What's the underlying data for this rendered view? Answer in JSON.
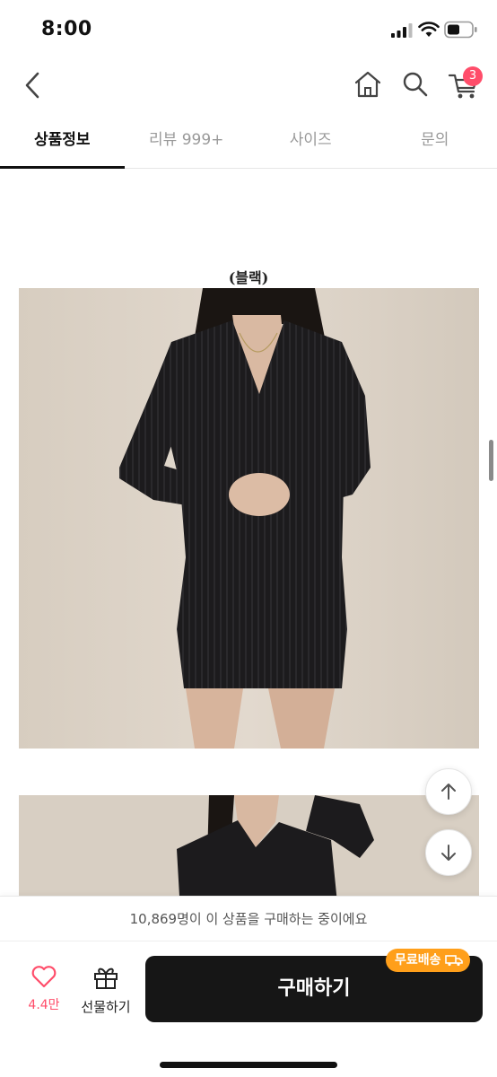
{
  "status_bar": {
    "time": "8:00",
    "icons": [
      "signal-icon",
      "wifi-icon",
      "battery-icon"
    ]
  },
  "nav": {
    "icons": [
      "back-icon",
      "home-icon",
      "search-icon",
      "cart-icon"
    ],
    "cart_badge": "3",
    "badge_color": "#ff4d6a"
  },
  "tabs": [
    {
      "label": "상품정보",
      "active": true
    },
    {
      "label": "리뷰 999+",
      "active": false
    },
    {
      "label": "사이즈",
      "active": false
    },
    {
      "label": "문의",
      "active": false
    }
  ],
  "content": {
    "color_caption": "(블랙)"
  },
  "floating_buttons": [
    "arrow-up-icon",
    "arrow-down-icon"
  ],
  "buyers_notice": "10,869명이 이 상품을 구매하는 중이에요",
  "action_bar": {
    "like_count": "4.4만",
    "gift_label": "선물하기",
    "buy_label": "구매하기",
    "free_shipping_label": "무료배송",
    "accent_color": "#ff4d6a",
    "badge_color": "#ff9f1a",
    "button_color": "#161616"
  }
}
